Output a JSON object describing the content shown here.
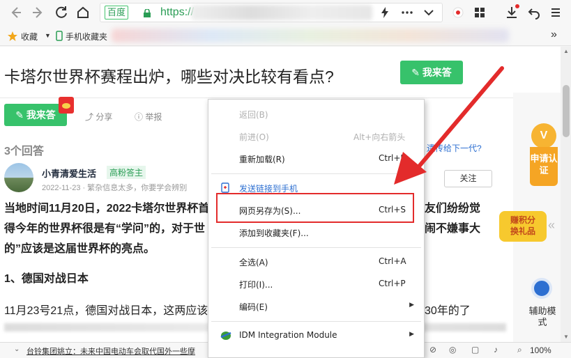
{
  "toolbar": {
    "address": {
      "site_badge": "百度",
      "url_prefix": "https://"
    },
    "icons": [
      "back-icon",
      "forward-icon",
      "refresh-icon",
      "home-icon",
      "bolt-icon",
      "more-icon",
      "dropdown-icon",
      "record-icon",
      "apps-icon",
      "download-icon",
      "undo-icon",
      "menu-icon"
    ]
  },
  "bookmarks": {
    "favorites": "收藏",
    "mobile_favorites": "手机收藏夹",
    "more": "»"
  },
  "page": {
    "question_title": "卡塔尔世界杯赛程出炉，哪些对决比较有看点?",
    "answer_button": "我来答",
    "answer_button2": "我来答",
    "share": "分享",
    "report": "举报",
    "answers_count": "3个回答",
    "side_question": "遗传给下一代?",
    "author": "小青清爱生活",
    "author_badge": "高粉答主",
    "meta": "2022-11-23 · 繁杂信息太多，你要学会辨别",
    "follow": "关注",
    "para1_line1": "当地时间11月20日，2022卡塔尔世界杯首",
    "para1_line1_tail": "友们纷纷觉",
    "para1_line2": "得今年的世界杯很是有“学问”的，对于世",
    "para1_line2_tail": "闹不嫌事大",
    "para1_line3": "的”应该是这届世界杯的亮点。",
    "heading": "1、德国对战日本",
    "para2": "11月23号21点，德国对战日本，这两应该",
    "para2_tail": "30年的了"
  },
  "right_panel": {
    "apply_cert": "申请认证",
    "points": "赚积分换礼品",
    "assist": "辅助模式"
  },
  "status_bar": {
    "news": "台铃集团姚立：未来中国电动车会取代国外一些摩",
    "zoom": "100%"
  },
  "context_menu": {
    "items": [
      {
        "label": "返回(B)",
        "shortcut": "",
        "disabled": true
      },
      {
        "label": "前进(O)",
        "shortcut": "Alt+向右箭头",
        "disabled": true
      },
      {
        "label": "重新加载(R)",
        "shortcut": "Ctrl+R",
        "disabled": false
      },
      {
        "label": "发送链接到手机",
        "shortcut": "",
        "disabled": false
      },
      {
        "label": "网页另存为(S)...",
        "shortcut": "Ctrl+S",
        "disabled": false
      },
      {
        "label": "添加到收藏夹(F)...",
        "shortcut": "",
        "disabled": false
      },
      {
        "label": "全选(A)",
        "shortcut": "Ctrl+A",
        "disabled": false
      },
      {
        "label": "打印(I)...",
        "shortcut": "Ctrl+P",
        "disabled": false
      },
      {
        "label": "编码(E)",
        "shortcut": "",
        "disabled": false
      },
      {
        "label": "IDM Integration Module",
        "shortcut": "",
        "disabled": false
      }
    ]
  },
  "colors": {
    "accent_green": "#37c26b",
    "highlight_red": "#e32b2b",
    "link_blue": "#2d6fd1"
  }
}
